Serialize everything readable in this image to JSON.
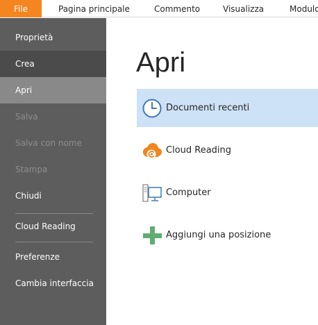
{
  "ribbon": {
    "tabs": [
      {
        "label": "File"
      },
      {
        "label": "Pagina principale"
      },
      {
        "label": "Commento"
      },
      {
        "label": "Visualizza"
      },
      {
        "label": "Modulo"
      }
    ]
  },
  "sidebar": {
    "items": [
      {
        "label": "Proprietà",
        "state": "normal"
      },
      {
        "label": "Crea",
        "state": "hover"
      },
      {
        "label": "Apri",
        "state": "selected"
      },
      {
        "label": "Salva",
        "state": "disabled"
      },
      {
        "label": "Salva con nome",
        "state": "disabled"
      },
      {
        "label": "Stampa",
        "state": "disabled"
      },
      {
        "label": "Chiudi",
        "state": "normal"
      },
      {
        "label": "Cloud Reading",
        "state": "normal"
      },
      {
        "label": "Preferenze",
        "state": "normal"
      },
      {
        "label": "Cambia interfaccia",
        "state": "normal"
      }
    ]
  },
  "main": {
    "title": "Apri",
    "locations": [
      {
        "label": "Documenti recenti",
        "icon": "clock-icon",
        "selected": true
      },
      {
        "label": "Cloud Reading",
        "icon": "cloud-icon",
        "selected": false
      },
      {
        "label": "Computer",
        "icon": "computer-icon",
        "selected": false
      },
      {
        "label": "Aggiungi una posizione",
        "icon": "plus-icon",
        "selected": false
      }
    ]
  },
  "colors": {
    "file_tab": "#f5851f",
    "sidebar_bg": "#5d5d5d",
    "sidebar_selected": "#898989",
    "sidebar_hover": "#4b4b4b",
    "selection_bg": "#cde1f7",
    "clock_icon": "#3f78b8",
    "cloud_icon": "#f2851f",
    "plus_icon": "#5fad72"
  }
}
